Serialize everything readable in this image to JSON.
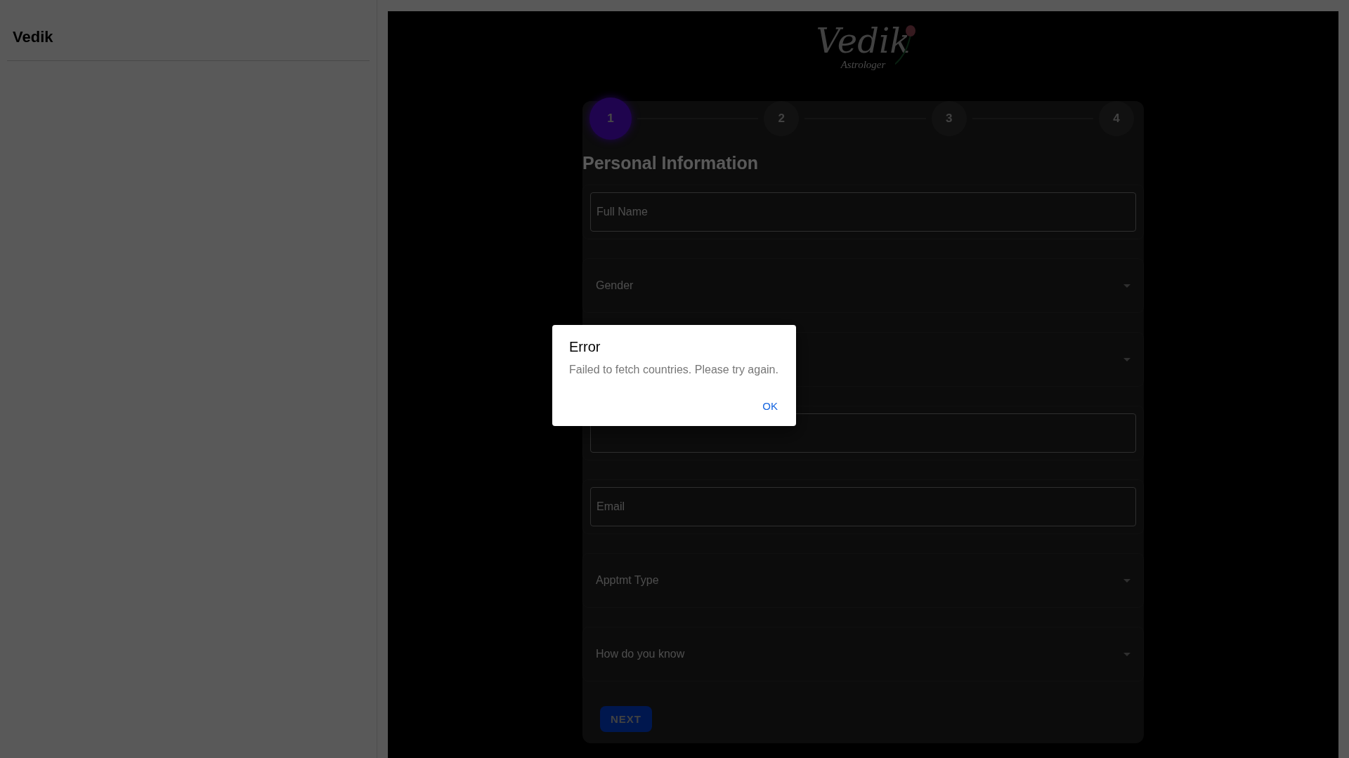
{
  "sidebar": {
    "title": "Vedik"
  },
  "logo": {
    "name": "Vedik",
    "tagline": "Astrologer"
  },
  "stepper": [
    {
      "label": "1",
      "selected": true
    },
    {
      "label": "2",
      "selected": false
    },
    {
      "label": "3",
      "selected": false
    },
    {
      "label": "4",
      "selected": false
    }
  ],
  "form": {
    "heading": "Personal Information",
    "fields": [
      {
        "kind": "text",
        "placeholder": "Full Name"
      },
      {
        "kind": "select",
        "label": "Gender"
      },
      {
        "kind": "select"
      },
      {
        "kind": "text"
      },
      {
        "kind": "text",
        "placeholder": "Email"
      },
      {
        "kind": "select",
        "label": "Apptmt Type"
      },
      {
        "kind": "select",
        "label": "How do you know"
      }
    ],
    "next_button": "NEXT"
  },
  "dialog": {
    "title": "Error",
    "message": "Failed to fetch countries. Please try again.",
    "button": "OK"
  }
}
